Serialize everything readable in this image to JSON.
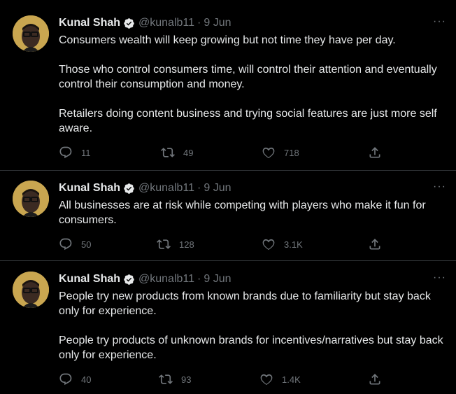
{
  "tweets": [
    {
      "name": "Kunal Shah",
      "handle": "@kunalb11",
      "separator": "·",
      "time": "9 Jun",
      "more": "···",
      "paragraphs": [
        "Consumers wealth will keep growing but not time they have per day.",
        "Those who control consumers time, will control their attention and eventually control their consumption and money.",
        "Retailers doing content business and trying social features are just more self aware."
      ],
      "replies": "11",
      "retweets": "49",
      "likes": "718"
    },
    {
      "name": "Kunal Shah",
      "handle": "@kunalb11",
      "separator": "·",
      "time": "9 Jun",
      "more": "···",
      "paragraphs": [
        "All businesses are at risk while competing with players who make it fun for consumers."
      ],
      "replies": "50",
      "retweets": "128",
      "likes": "3.1K"
    },
    {
      "name": "Kunal Shah",
      "handle": "@kunalb11",
      "separator": "·",
      "time": "9 Jun",
      "more": "···",
      "paragraphs": [
        "People try new products from known brands due to familiarity but stay back only for experience.",
        "People try products of unknown brands for incentives/narratives but stay back only for experience."
      ],
      "replies": "40",
      "retweets": "93",
      "likes": "1.4K"
    }
  ],
  "colors": {
    "background": "#000000",
    "text": "#e7e9ea",
    "muted": "#71767b",
    "verified": "#e7e9ea",
    "divider": "#2f3336"
  },
  "icons": [
    "verified-badge-icon",
    "more-icon",
    "reply-icon",
    "retweet-icon",
    "like-icon",
    "share-icon"
  ]
}
